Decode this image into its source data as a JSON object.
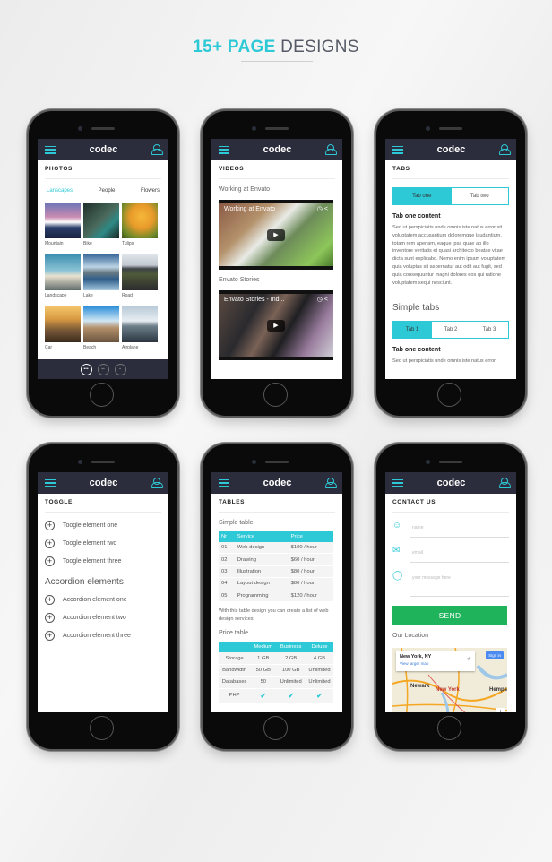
{
  "heading": {
    "accent": "15+ PAGE",
    "rest": " DESIGNS"
  },
  "app": {
    "logo": "codec",
    "accent_color": "#2ec9d6",
    "header_color": "#2b2c3c"
  },
  "photos": {
    "title": "PHOTOS",
    "tabs": [
      "Lanscapes",
      "People",
      "Flowers"
    ],
    "active_tab": "Lanscapes",
    "items": [
      "Mountain",
      "Bike",
      "Tulips",
      "Landscape",
      "Lake",
      "Road",
      "Car",
      "Beach",
      "Airplane"
    ],
    "bottom_nav": [
      "list-view-icon",
      "grid-view-icon",
      "single-view-icon"
    ]
  },
  "videos": {
    "title": "VIDEOS",
    "items": [
      {
        "label": "Working at Envato",
        "video_title": "Working at Envato"
      },
      {
        "label": "Envato Stories",
        "video_title": "Envato Stories - Ind..."
      }
    ]
  },
  "tabs": {
    "title": "TABS",
    "tabs": [
      "Tab one",
      "Tab two"
    ],
    "content_title": "Tab one content",
    "content_text": "Sed ut perspiciatis unde omnis iste natus error sit voluptatem accusantium doloremque laudantium, totam rem aperiam, eaque ipsa quae ab illo inventore veritatis et quasi architecto beatae vitae dicta sunt explicabo. Nemo enim ipsam voluptatem quia voluptas sit aspernatur aut odit aut fugit, sed quia consequuntur magni dolores eos qui ratione voluptatem sequi nesciunt.",
    "simple_title": "Simple tabs",
    "simple_tabs": [
      "Tab 1",
      "Tab 2",
      "Tab 3"
    ],
    "simple_content_title": "Tab one content",
    "simple_content_text": "Sed ut perspiciatis unde omnis iste natus error"
  },
  "toggle": {
    "title": "TOGGLE",
    "toggles": [
      "Toogle element one",
      "Toogle element two",
      "Toogle element three"
    ],
    "accordion_title": "Accordion elements",
    "accordions": [
      "Accordion element one",
      "Accordion element two",
      "Accordion element three"
    ]
  },
  "tables": {
    "title": "TABLES",
    "simple_title": "Simple table",
    "simple_headers": [
      "Nr",
      "Service",
      "Price"
    ],
    "simple_rows": [
      [
        "01",
        "Web design",
        "$100 / hour"
      ],
      [
        "02",
        "Drawing",
        "$60 / hour"
      ],
      [
        "03",
        "Illustration",
        "$80 / hour"
      ],
      [
        "04",
        "Layout design",
        "$80 / hour"
      ],
      [
        "05",
        "Programming",
        "$120 / hour"
      ]
    ],
    "note": "With this table design you can create a list of web design services.",
    "price_title": "Price table",
    "price_headers": [
      "",
      "Medium",
      "Business",
      "Deluxe"
    ],
    "price_rows": [
      [
        "Storage",
        "1 GB",
        "2 GB",
        "4 GB"
      ],
      [
        "Bandwidth",
        "50 GB",
        "100 GB",
        "Unlimited"
      ],
      [
        "Databases",
        "50",
        "Unlimited",
        "Unlimited"
      ],
      [
        "PHP",
        "✔",
        "✔",
        "✔"
      ]
    ]
  },
  "contact": {
    "title": "CONTACT US",
    "name_placeholder": "name",
    "email_placeholder": "email",
    "message_placeholder": "your message here",
    "send_label": "SEND",
    "location_title": "Our Location",
    "map": {
      "place": "New York, NY",
      "link": "View larger map",
      "signin": "Sign in",
      "labels": [
        "Newark",
        "New York",
        "Hempst"
      ]
    }
  }
}
